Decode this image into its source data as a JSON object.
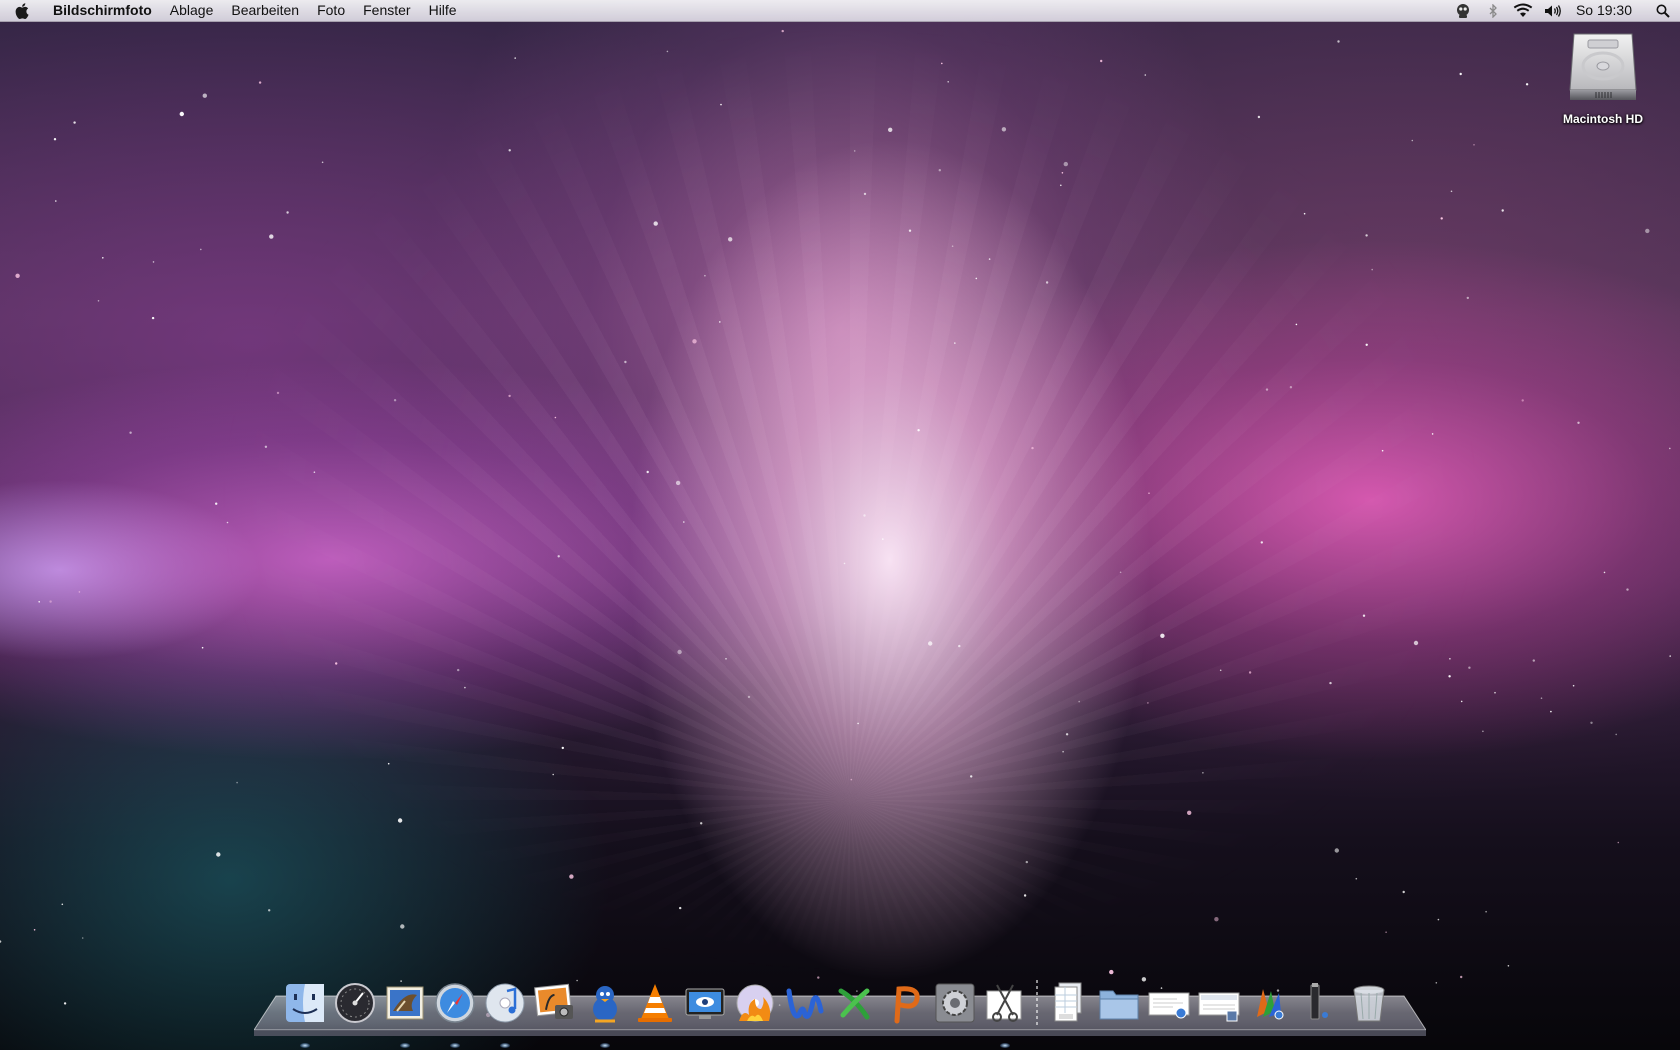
{
  "menubar": {
    "apple_icon": "apple-logo-icon",
    "app_name": "Bildschirmfoto",
    "menus": [
      "Ablage",
      "Bearbeiten",
      "Foto",
      "Fenster",
      "Hilfe"
    ],
    "status_icons": [
      "script-menu-icon",
      "bluetooth-icon",
      "wifi-icon",
      "volume-icon"
    ],
    "clock": "So 19:30",
    "spotlight_icon": "spotlight-search-icon"
  },
  "desktop": {
    "icons": [
      {
        "label": "Macintosh HD",
        "icon": "hard-drive-icon"
      }
    ]
  },
  "dock": {
    "apps": [
      {
        "icon": "finder-icon",
        "running": true
      },
      {
        "icon": "dashboard-icon",
        "running": false
      },
      {
        "icon": "mail-icon",
        "running": true
      },
      {
        "icon": "safari-icon",
        "running": true
      },
      {
        "icon": "itunes-icon",
        "running": true
      },
      {
        "icon": "iphoto-icon",
        "running": false
      },
      {
        "icon": "adium-icon",
        "running": true
      },
      {
        "icon": "vlc-icon",
        "running": false
      },
      {
        "icon": "preview-monitor-icon",
        "running": false
      },
      {
        "icon": "burn-icon",
        "running": false
      },
      {
        "icon": "word-icon",
        "running": false
      },
      {
        "icon": "excel-icon",
        "running": false
      },
      {
        "icon": "powerpoint-icon",
        "running": false
      },
      {
        "icon": "system-preferences-icon",
        "running": false
      },
      {
        "icon": "grab-screenshot-icon",
        "running": true
      }
    ],
    "stacks": [
      {
        "icon": "spreadsheet-document-icon"
      },
      {
        "icon": "folder-icon"
      },
      {
        "icon": "documents-stack-icon"
      },
      {
        "icon": "downloads-stack-icon"
      },
      {
        "icon": "office-stack-icon"
      },
      {
        "icon": "usb-drive-icon"
      },
      {
        "icon": "trash-icon"
      }
    ]
  },
  "colors": {
    "menubar_bg": "#eeeaf2",
    "wallpaper_highlight": "#ffd8f0",
    "wallpaper_pink": "#e060b8",
    "wallpaper_dark": "#0a080e"
  }
}
